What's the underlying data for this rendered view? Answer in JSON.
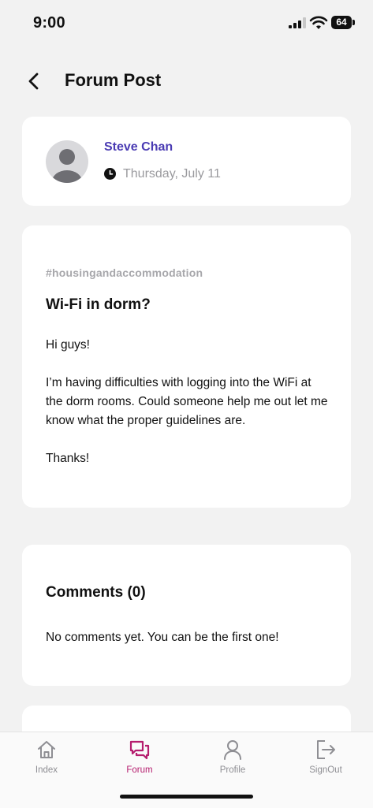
{
  "status_bar": {
    "time": "9:00",
    "battery": "64"
  },
  "header": {
    "title": "Forum Post"
  },
  "author": {
    "name": "Steve Chan",
    "date": "Thursday, July 11"
  },
  "post": {
    "tag": "#housingandaccommodation",
    "title": "Wi-Fi in dorm?",
    "paragraphs": [
      "Hi guys!",
      "I’m having difficulties with logging into the WiFi at the dorm rooms. Could someone help me out let me know what the proper guidelines are.",
      "Thanks!"
    ]
  },
  "comments": {
    "title": "Comments (0)",
    "empty_message": "No comments yet. You can be the first one!"
  },
  "tabbar": {
    "items": [
      {
        "label": "Index",
        "icon": "home-icon"
      },
      {
        "label": "Forum",
        "icon": "chat-bubbles-icon",
        "active": true
      },
      {
        "label": "Profile",
        "icon": "person-icon"
      },
      {
        "label": "SignOut",
        "icon": "sign-out-icon"
      }
    ]
  },
  "colors": {
    "accent": "#b51d6e",
    "author_name": "#4a3bb3",
    "background": "#f2f2f2"
  }
}
